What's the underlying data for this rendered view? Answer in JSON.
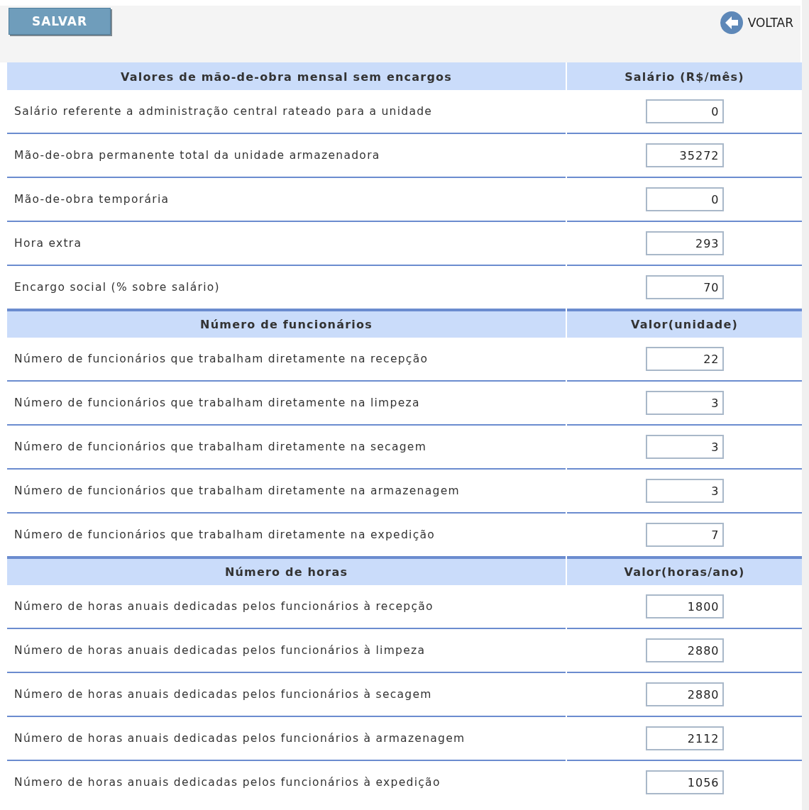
{
  "toolbar": {
    "save_button": "SALVAR",
    "back_link": "VOLTAR"
  },
  "sections": [
    {
      "heading": "Valores de mão-de-obra mensal sem encargos",
      "value_heading": "Salário (R$/mês)",
      "rows": [
        {
          "label": "Salário referente a administração central rateado para a unidade",
          "value": "0"
        },
        {
          "label": "Mão-de-obra permanente total da unidade armazenadora",
          "value": "35272"
        },
        {
          "label": "Mão-de-obra temporária",
          "value": "0"
        },
        {
          "label": "Hora extra",
          "value": "293"
        },
        {
          "label": "Encargo social (% sobre salário)",
          "value": "70"
        }
      ]
    },
    {
      "heading": "Número de funcionários",
      "value_heading": "Valor(unidade)",
      "rows": [
        {
          "label": "Número de funcionários que trabalham diretamente na recepção",
          "value": "22"
        },
        {
          "label": "Número de funcionários que trabalham diretamente na limpeza",
          "value": "3"
        },
        {
          "label": "Número de funcionários que trabalham diretamente na secagem",
          "value": "3"
        },
        {
          "label": "Número de funcionários que trabalham diretamente na armazenagem",
          "value": "3"
        },
        {
          "label": "Número de funcionários que trabalham diretamente na expedição",
          "value": "7"
        }
      ]
    },
    {
      "heading": "Número de horas",
      "value_heading": "Valor(horas/ano)",
      "rows": [
        {
          "label": "Número de horas anuais dedicadas pelos funcionários à recepção",
          "value": "1800"
        },
        {
          "label": "Número de horas anuais dedicadas pelos funcionários à limpeza",
          "value": "2880"
        },
        {
          "label": "Número de horas anuais dedicadas pelos funcionários à secagem",
          "value": "2880"
        },
        {
          "label": "Número de horas anuais dedicadas pelos funcionários à armazenagem",
          "value": "2112"
        },
        {
          "label": "Número de horas anuais dedicadas pelos funcionários à expedição",
          "value": "1056"
        }
      ]
    }
  ]
}
